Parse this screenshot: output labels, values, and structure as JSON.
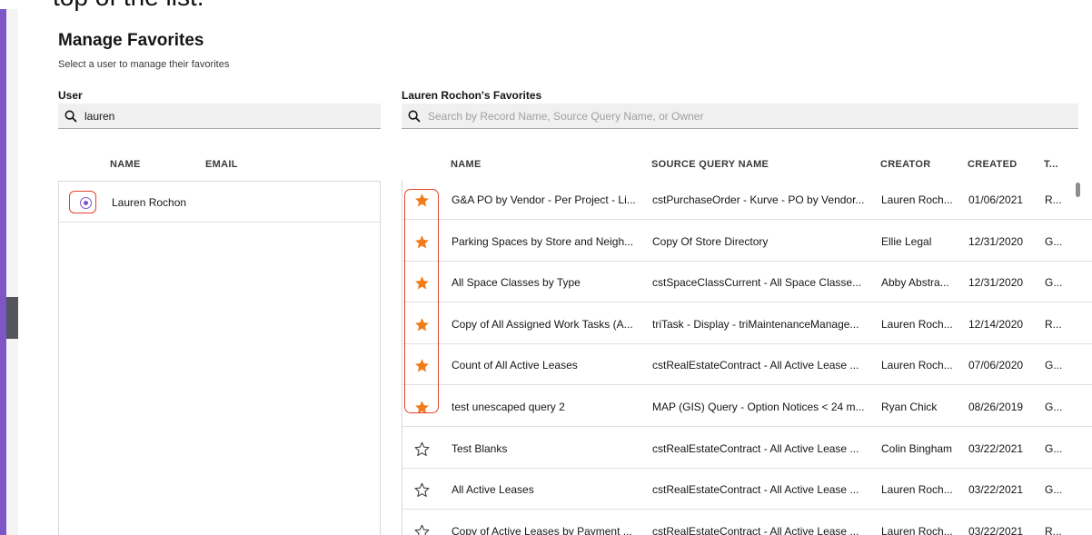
{
  "caption": "top of the list.",
  "page": {
    "title": "Manage Favorites",
    "subtitle": "Select a user to manage their favorites"
  },
  "user_section": {
    "label": "User",
    "search_value": "lauren",
    "columns": [
      "NAME",
      "EMAIL"
    ],
    "users": [
      {
        "name": "Lauren Rochon",
        "email": "",
        "selected": true
      }
    ]
  },
  "favorites_section": {
    "label": "Lauren Rochon's Favorites",
    "search_placeholder": "Search by Record Name, Source Query Name, or Owner",
    "columns": [
      "NAME",
      "SOURCE QUERY NAME",
      "CREATOR",
      "CREATED",
      "T..."
    ],
    "rows": [
      {
        "favorite": true,
        "name": "G&A PO by Vendor - Per Project - Li...",
        "source": "cstPurchaseOrder - Kurve - PO by Vendor...",
        "creator": "Lauren Roch...",
        "created": "01/06/2021",
        "type": "R..."
      },
      {
        "favorite": true,
        "name": "Parking Spaces by Store and Neigh...",
        "source": "Copy Of Store Directory",
        "creator": "Ellie Legal",
        "created": "12/31/2020",
        "type": "G..."
      },
      {
        "favorite": true,
        "name": "All Space Classes by Type",
        "source": "cstSpaceClassCurrent - All Space Classe...",
        "creator": "Abby Abstra...",
        "created": "12/31/2020",
        "type": "G..."
      },
      {
        "favorite": true,
        "name": "Copy of All Assigned Work Tasks (A...",
        "source": "triTask - Display - triMaintenanceManage...",
        "creator": "Lauren Roch...",
        "created": "12/14/2020",
        "type": "R..."
      },
      {
        "favorite": true,
        "name": "Count of All Active Leases",
        "source": "cstRealEstateContract - All Active Lease ...",
        "creator": "Lauren Roch...",
        "created": "07/06/2020",
        "type": "G..."
      },
      {
        "favorite": true,
        "name": "test unescaped query 2",
        "source": "MAP (GIS) Query - Option Notices < 24 m...",
        "creator": "Ryan Chick",
        "created": "08/26/2019",
        "type": "G..."
      },
      {
        "favorite": false,
        "name": "Test Blanks",
        "source": "cstRealEstateContract - All Active Lease ...",
        "creator": "Colin Bingham",
        "created": "03/22/2021",
        "type": "G..."
      },
      {
        "favorite": false,
        "name": "All Active Leases",
        "source": "cstRealEstateContract - All Active Lease ...",
        "creator": "Lauren Roch...",
        "created": "03/22/2021",
        "type": "G..."
      },
      {
        "favorite": false,
        "name": "Copy of Active Leases by Payment ...",
        "source": "cstRealEstateContract - All Active Lease ...",
        "creator": "Lauren Roch...",
        "created": "03/22/2021",
        "type": "R..."
      }
    ]
  },
  "colors": {
    "accent": "#7d55c7",
    "star_filled": "#f07c1a",
    "highlight_outline": "#e5442c"
  },
  "icons": {
    "search": "search-icon",
    "favorite_on": "star-filled-icon",
    "favorite_off": "star-outline-icon",
    "user_select": "radio-selected-icon"
  }
}
